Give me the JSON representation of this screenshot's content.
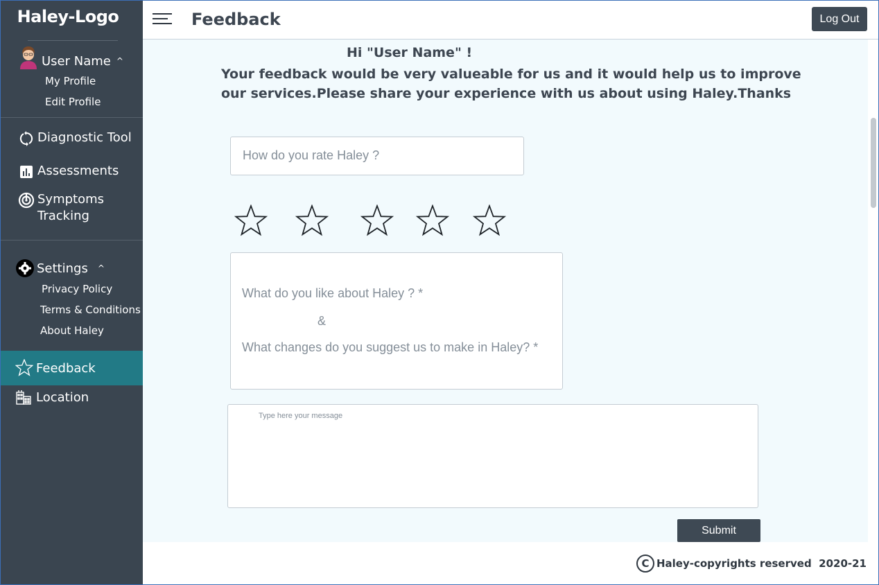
{
  "sidebar": {
    "logo": "Haley-Logo",
    "user": {
      "name": "User Name",
      "caret": "^",
      "sub": [
        "My Profile",
        "Edit Profile"
      ]
    },
    "nav": {
      "diagnostic": "Diagnostic Tool",
      "assessments": "Assessments",
      "symptoms_line1": "Symptoms",
      "symptoms_line2": "Tracking"
    },
    "settings": {
      "label": "Settings",
      "caret": "^",
      "sub": [
        "Privacy Policy",
        "Terms & Conditions",
        "About Haley"
      ]
    },
    "feedback": "Feedback",
    "location": "Location",
    "colors": {
      "background": "#3a4550",
      "active": "#227a86"
    }
  },
  "header": {
    "title": "Feedback",
    "logout": "Log Out"
  },
  "main": {
    "greeting": "Hi \"User Name\" !",
    "intro_line1": "Your feedback would be very valueable for us and it would help us to improve",
    "intro_line2": "our services.Please share your experience with us about using Haley.Thanks",
    "rate_prompt": "How do you rate Haley ?",
    "rating": {
      "value": 0,
      "max": 5
    },
    "like_prompt": "What do you like about Haley ? *",
    "ampersand": "&",
    "change_prompt": "What changes do you suggest us to make in Haley? *",
    "message_placeholder": "Type here your message",
    "submit": "Submit"
  },
  "footer": {
    "copyright_symbol": "C",
    "copyright": "Haley-copyrights reserved  2020-21"
  }
}
